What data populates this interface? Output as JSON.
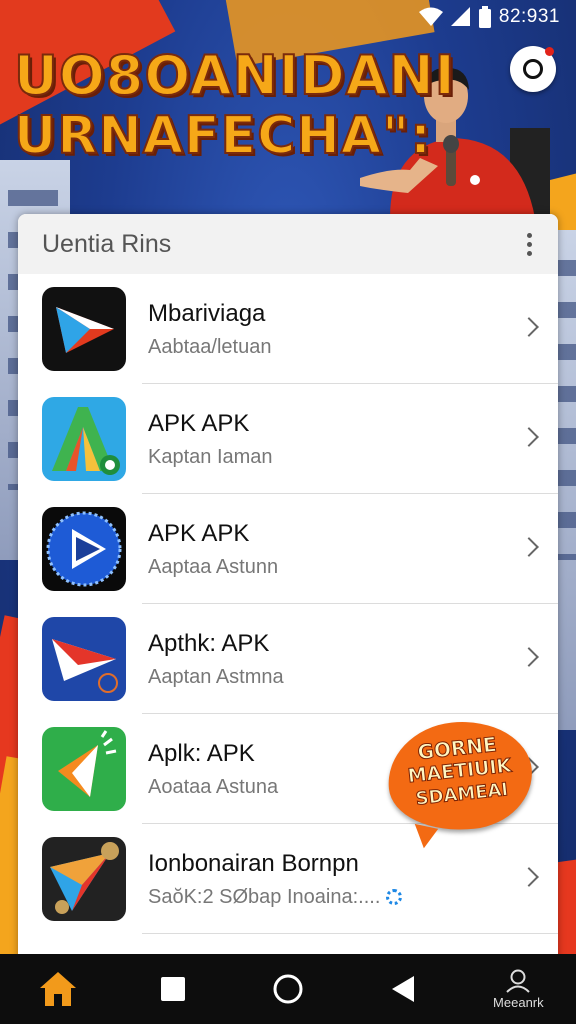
{
  "status_bar": {
    "time": "82:931",
    "icons": [
      "wifi-icon",
      "cellular-signal-icon",
      "battery-icon"
    ]
  },
  "banner": {
    "title_line1": "UO8OANIDANI",
    "title_line2": "URNAFECHA\":",
    "record_button_icon": "record-icon"
  },
  "card": {
    "title": "Uentia Rins",
    "menu_icon": "more-vertical-icon"
  },
  "apps": [
    {
      "name": "Mbariviaga",
      "subtitle": "Aabtaa/letuan",
      "icon": "play-arrow-black-icon"
    },
    {
      "name": "APK APK",
      "subtitle": "Kaptan Iaman",
      "icon": "letter-a-blue-icon"
    },
    {
      "name": "APK APK",
      "subtitle": "Aaptaa Astunn",
      "icon": "compass-play-icon"
    },
    {
      "name": "Apthk: APK",
      "subtitle": "Aaptan Astmna",
      "icon": "paper-plane-blue-icon"
    },
    {
      "name": "Aplk: APK",
      "subtitle": "Aoataa Astuna",
      "icon": "green-megaphone-icon"
    },
    {
      "name": "Ionbonairan Bornpn",
      "subtitle": "SaŏK:2 SØbap Inoaina:....",
      "icon": "dark-paper-plane-icon"
    }
  ],
  "promo": {
    "line1": "GORNE",
    "line2": "MAETIUIK",
    "line3": "SDAMEAI"
  },
  "nav": {
    "home_icon": "home-icon",
    "recents_icon": "square-icon",
    "circle_icon": "circle-home-icon",
    "back_icon": "back-triangle-icon",
    "profile_icon": "person-icon",
    "profile_label": "Meeanrk"
  },
  "colors": {
    "banner_blue": "#1d3c8f",
    "title_orange": "#f6a818",
    "accent_red": "#e23a1e",
    "home_orange": "#f29a1b",
    "promo_orange": "#f36a13"
  }
}
